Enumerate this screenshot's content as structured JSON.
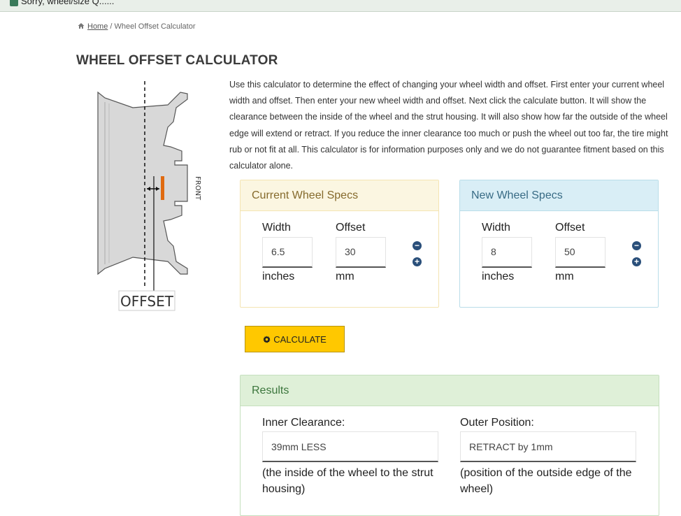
{
  "browser": {
    "tab_title": "Sorry, wheel/size Q......"
  },
  "breadcrumb": {
    "home": "Home",
    "separator": "/",
    "current": "Wheel Offset Calculator"
  },
  "page": {
    "title": "WHEEL OFFSET CALCULATOR",
    "intro": "Use this calculator to determine the effect of changing your wheel width and offset. First enter your current wheel width and offset. Then enter your new wheel width and offset. Next click the calculate button. It will show the clearance between the inside of the wheel and the strut housing. It will also show how far the outside of the wheel edge will extend or retract. If you reduce the inner clearance too much or push the wheel out too far, the tire might rub or not fit at all. This calculator is for information purposes only and we do not guarantee fitment based on this calculator alone."
  },
  "diagram": {
    "offset_label": "OFFSET",
    "front_label": "FRONT"
  },
  "current": {
    "title": "Current Wheel Specs",
    "width_label": "Width",
    "width_value": "6.5",
    "width_unit": "inches",
    "offset_label": "Offset",
    "offset_value": "30",
    "offset_unit": "mm"
  },
  "newspec": {
    "title": "New Wheel Specs",
    "width_label": "Width",
    "width_value": "8",
    "width_unit": "inches",
    "offset_label": "Offset",
    "offset_value": "50",
    "offset_unit": "mm"
  },
  "stepper": {
    "minus": "−",
    "plus": "+"
  },
  "calculate": {
    "icon": "gear-icon",
    "label": "CALCULATE"
  },
  "results": {
    "title": "Results",
    "inner_label": "Inner Clearance:",
    "inner_value": "39mm LESS",
    "inner_note": "(the inside of the wheel to the strut housing)",
    "outer_label": "Outer Position:",
    "outer_value": "RETRACT by 1mm",
    "outer_note": "(position of the outside edge of the wheel)"
  },
  "colors": {
    "current_header_bg": "#fbf6e1",
    "new_header_bg": "#d9eef6",
    "results_header_bg": "#dff0d8",
    "calculate_bg": "#ffc800",
    "stepper": "#2a4f7a"
  }
}
